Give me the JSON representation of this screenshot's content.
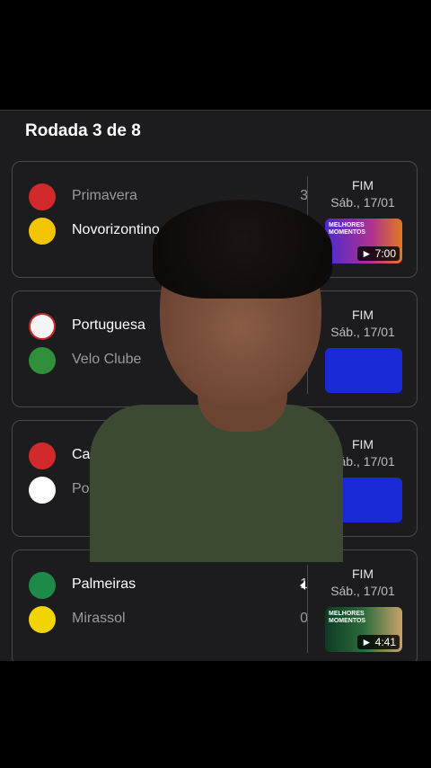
{
  "round": {
    "title": "Rodada 3 de 8"
  },
  "matches": [
    {
      "home": {
        "name": "Primavera",
        "score": "3",
        "crest_color": "#d22a2a"
      },
      "away": {
        "name": "Novorizontino",
        "score": "",
        "crest_color": "#f2c500"
      },
      "status": "FIM",
      "date": "Sáb., 17/01",
      "video": {
        "duration": "7:00",
        "label": "MELHORES MOMENTOS"
      }
    },
    {
      "home": {
        "name": "Portuguesa",
        "score": "",
        "crest_color": "#c02a2a"
      },
      "away": {
        "name": "Velo Clube",
        "score": "",
        "crest_color": "#2f8f3a"
      },
      "status": "FIM",
      "date": "Sáb., 17/01",
      "video": {
        "duration": "",
        "label": ""
      }
    },
    {
      "home": {
        "name": "Ca",
        "score": "",
        "crest_color": "#d22a2a"
      },
      "away": {
        "name": "Po",
        "score": "",
        "crest_color": "#ffffff"
      },
      "status": "FIM",
      "date": "Sáb., 17/01",
      "video": {
        "duration": "",
        "label": ""
      }
    },
    {
      "home": {
        "name": "Palmeiras",
        "score": "1",
        "crest_color": "#1e8a4a"
      },
      "away": {
        "name": "Mirassol",
        "score": "0",
        "crest_color": "#f2d400"
      },
      "status": "FIM",
      "date": "Sáb., 17/01",
      "video": {
        "duration": "4:41",
        "label": "MELHORES MOMENTOS"
      }
    }
  ],
  "colors": {
    "panel": "#1c1c1e",
    "card_border": "#4a4a4e",
    "thumb_blue": "#1a2ad8"
  }
}
